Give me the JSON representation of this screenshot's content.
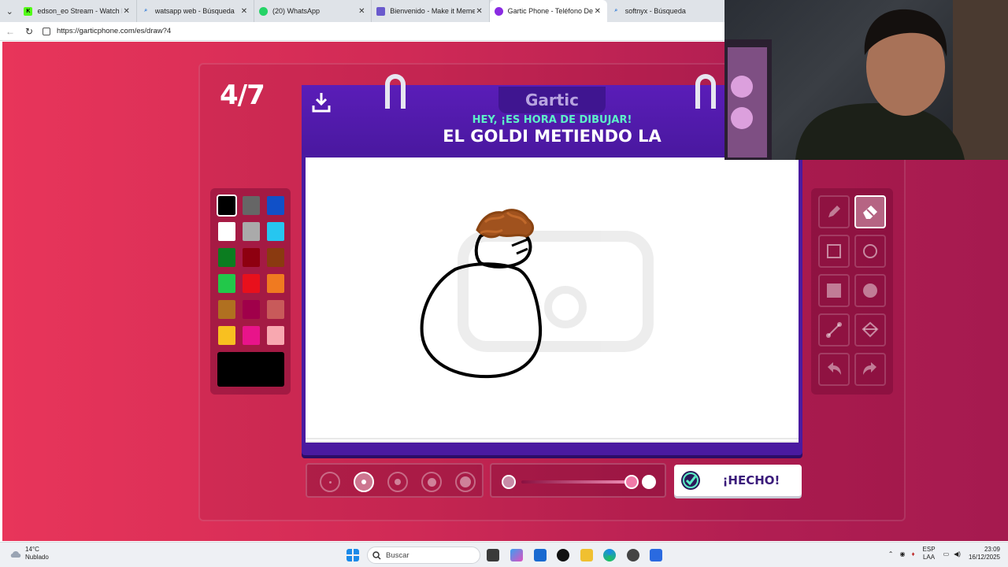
{
  "browser": {
    "tabs": [
      {
        "title": "edson_eo Stream - Watch Live",
        "favicon": "kick-icon",
        "color": "#53fc18"
      },
      {
        "title": "watsapp web - Búsqueda",
        "favicon": "search-icon",
        "color": "#2f7bd8"
      },
      {
        "title": "(20) WhatsApp",
        "favicon": "whatsapp-icon",
        "color": "#25d366"
      },
      {
        "title": "Bienvenido - Make it Meme",
        "favicon": "meme-icon",
        "color": "#6a5acd"
      },
      {
        "title": "Gartic Phone - Teléfono Descompuesto",
        "favicon": "gartic-icon",
        "color": "#8a2be2",
        "active": true
      },
      {
        "title": "softnyx - Búsqueda",
        "favicon": "search-icon",
        "color": "#2f7bd8"
      }
    ],
    "url": "https://garticphone.com/es/draw?4"
  },
  "game": {
    "round": "4/7",
    "logo": "Gartic",
    "prompt_heading": "HEY, ¡ES HORA DE DIBUJAR!",
    "prompt_phrase": "EL GOLDI METIENDO LA",
    "done_label": "¡HECHO!",
    "palette": [
      "#000000",
      "#666666",
      "#1050c8",
      "#ffffff",
      "#aaaaaa",
      "#26c6f0",
      "#0b7d20",
      "#8e0010",
      "#8a3a10",
      "#22c84a",
      "#e8101c",
      "#f07a20",
      "#b07020",
      "#a0004a",
      "#c85a5a",
      "#f8c020",
      "#e8148a",
      "#f8a8b0"
    ],
    "selected_color": "#000000",
    "tools": [
      "pencil-icon",
      "eraser-icon",
      "rect-outline-icon",
      "circle-outline-icon",
      "rect-fill-icon",
      "circle-fill-icon",
      "line-icon",
      "bucket-icon",
      "undo-icon",
      "redo-icon"
    ],
    "selected_tool": "eraser-icon",
    "brush_sizes": 5,
    "selected_brush_size": 2,
    "opacity_level": 1.0
  },
  "taskbar": {
    "weather_temp": "14°C",
    "weather_desc": "Nublado",
    "search_label": "Buscar",
    "lang_top": "ESP",
    "lang_bottom": "LAA",
    "time": "23:09",
    "date": "16/12/2025"
  }
}
